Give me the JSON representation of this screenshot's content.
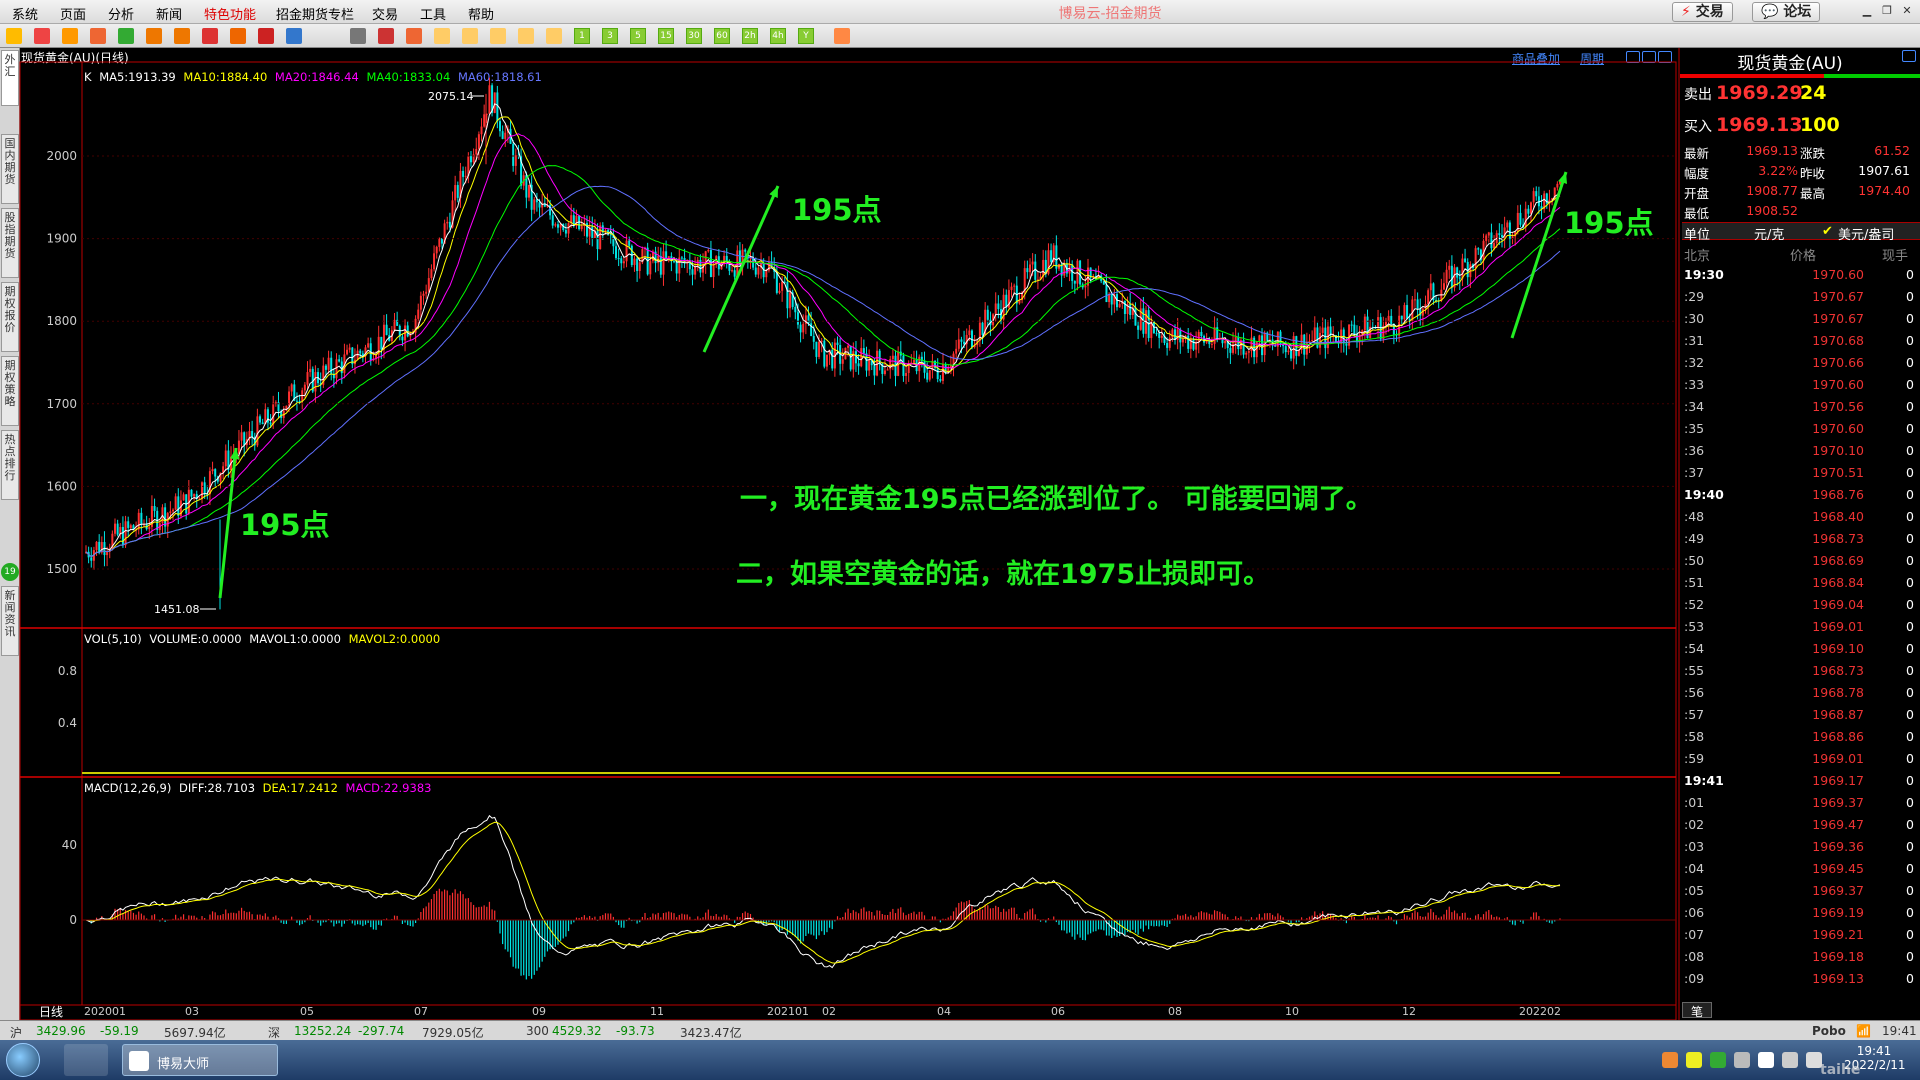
{
  "menu": [
    "系统",
    "页面",
    "分析",
    "新闻",
    "特色功能",
    "招金期货专栏",
    "交易",
    "工具",
    "帮助"
  ],
  "app_title": "博易云-招金期货",
  "top_buttons": {
    "trade": "交易",
    "forum": "论坛"
  },
  "left_tabs": [
    "外汇",
    "国内期货",
    "股指期货",
    "期权报价",
    "期权策略",
    "热点排行",
    "新闻资讯"
  ],
  "left_badge": "19",
  "chart": {
    "title": "现货黄金(AU)(日线)",
    "links": [
      "商品叠加",
      "周期"
    ],
    "k_legend": {
      "label": "K",
      "ma5": "MA5:1913.39",
      "ma10": "MA10:1884.40",
      "ma20": "MA20:1846.44",
      "ma40": "MA40:1833.04",
      "ma60": "MA60:1818.61"
    },
    "vol_legend": {
      "label": "VOL(5,10)",
      "volume": "VOLUME:0.0000",
      "mavol1": "MAVOL1:0.0000",
      "mavol2": "MAVOL2:0.0000"
    },
    "macd_legend": {
      "label": "MACD(12,26,9)",
      "diff": "DIFF:28.7103",
      "dea": "DEA:17.2412",
      "macd": "MACD:22.9383"
    },
    "price_ticks": [
      "2000",
      "1900",
      "1800",
      "1700",
      "1600",
      "1500"
    ],
    "vol_ticks": [
      "0.8",
      "0.4"
    ],
    "macd_ticks": [
      "40",
      "0"
    ],
    "date_ticks": [
      "202001",
      "03",
      "05",
      "07",
      "09",
      "11",
      "202101",
      "02",
      "04",
      "06",
      "08",
      "10",
      "12",
      "202202"
    ],
    "period_label": "日线",
    "high_label": "2075.14",
    "low_label": "1451.08",
    "annotations": {
      "a1": "195点",
      "a2": "195点",
      "a3": "195点",
      "line1": "一，现在黄金195点已经涨到位了。 可能要回调了。",
      "line2": "二，如果空黄金的话，就在1975止损即可。"
    }
  },
  "chart_data": {
    "type": "line",
    "title": "现货黄金(AU)(日线)",
    "x": [
      "202001",
      "202003",
      "202005",
      "202007",
      "202008",
      "202009",
      "202011",
      "202101",
      "202102",
      "202104",
      "202106",
      "202108",
      "202110",
      "202112",
      "202202"
    ],
    "values": [
      1520,
      1580,
      1720,
      1800,
      2075.14,
      1940,
      1870,
      1870,
      1760,
      1740,
      1880,
      1780,
      1770,
      1800,
      1969.13
    ],
    "ylim": [
      1450,
      2080
    ],
    "high": 2075.14,
    "low": 1451.08,
    "colors": {
      "up": "#ff3030",
      "down": "#00e5e5",
      "ma5": "#ffffff",
      "ma10": "#ffff00",
      "ma20": "#ff00ff",
      "ma40": "#00ff00",
      "ma60": "#6070ff"
    }
  },
  "quote": {
    "title": "现货黄金(AU)",
    "sell_label": "卖出",
    "sell_price": "1969.29",
    "sell_vol": "24",
    "buy_label": "买入",
    "buy_price": "1969.13",
    "buy_vol": "100",
    "rows": [
      {
        "l1": "最新",
        "v1": "1969.13",
        "l2": "涨跌",
        "v2": "61.52"
      },
      {
        "l1": "幅度",
        "v1": "3.22%",
        "l2": "昨收",
        "v2": "1907.61"
      },
      {
        "l1": "开盘",
        "v1": "1908.77",
        "l2": "最高",
        "v2": "1974.40"
      },
      {
        "l1": "最低",
        "v1": "1908.52",
        "l2": "",
        "v2": ""
      }
    ],
    "unit_label": "单位",
    "unit_value": "元/克",
    "unit_alt": "美元/盎司",
    "tick_headers": {
      "time": "北京",
      "price": "价格",
      "vol": "现手"
    },
    "ticks": [
      {
        "t": "19:30",
        "p": "1970.60",
        "v": "0",
        "b": true
      },
      {
        "t": ":29",
        "p": "1970.67",
        "v": "0"
      },
      {
        "t": ":30",
        "p": "1970.67",
        "v": "0"
      },
      {
        "t": ":31",
        "p": "1970.68",
        "v": "0"
      },
      {
        "t": ":32",
        "p": "1970.66",
        "v": "0"
      },
      {
        "t": ":33",
        "p": "1970.60",
        "v": "0"
      },
      {
        "t": ":34",
        "p": "1970.56",
        "v": "0"
      },
      {
        "t": ":35",
        "p": "1970.60",
        "v": "0"
      },
      {
        "t": ":36",
        "p": "1970.10",
        "v": "0"
      },
      {
        "t": ":37",
        "p": "1970.51",
        "v": "0"
      },
      {
        "t": "19:40",
        "p": "1968.76",
        "v": "0",
        "b": true
      },
      {
        "t": ":48",
        "p": "1968.40",
        "v": "0"
      },
      {
        "t": ":49",
        "p": "1968.73",
        "v": "0"
      },
      {
        "t": ":50",
        "p": "1968.69",
        "v": "0"
      },
      {
        "t": ":51",
        "p": "1968.84",
        "v": "0"
      },
      {
        "t": ":52",
        "p": "1969.04",
        "v": "0"
      },
      {
        "t": ":53",
        "p": "1969.01",
        "v": "0"
      },
      {
        "t": ":54",
        "p": "1969.10",
        "v": "0"
      },
      {
        "t": ":55",
        "p": "1968.73",
        "v": "0"
      },
      {
        "t": ":56",
        "p": "1968.78",
        "v": "0"
      },
      {
        "t": ":57",
        "p": "1968.87",
        "v": "0"
      },
      {
        "t": ":58",
        "p": "1968.86",
        "v": "0"
      },
      {
        "t": ":59",
        "p": "1969.01",
        "v": "0"
      },
      {
        "t": "19:41",
        "p": "1969.17",
        "v": "0",
        "b": true
      },
      {
        "t": ":01",
        "p": "1969.37",
        "v": "0"
      },
      {
        "t": ":02",
        "p": "1969.47",
        "v": "0"
      },
      {
        "t": ":03",
        "p": "1969.36",
        "v": "0"
      },
      {
        "t": ":04",
        "p": "1969.45",
        "v": "0"
      },
      {
        "t": ":05",
        "p": "1969.37",
        "v": "0"
      },
      {
        "t": ":06",
        "p": "1969.19",
        "v": "0"
      },
      {
        "t": ":07",
        "p": "1969.21",
        "v": "0"
      },
      {
        "t": ":08",
        "p": "1969.18",
        "v": "0"
      },
      {
        "t": ":09",
        "p": "1969.13",
        "v": "0"
      }
    ],
    "bottom_tab": "笔"
  },
  "status": {
    "items": [
      {
        "k": "沪",
        "v": "3429.96",
        "c": "-59.19",
        "a": "5697.94亿"
      },
      {
        "k": "深",
        "v": "13252.24",
        "c": "-297.74",
        "a": "7929.05亿"
      },
      {
        "k": "300",
        "v": "4529.32",
        "c": "-93.73",
        "a": "3423.47亿"
      }
    ],
    "brand": "Pobo",
    "time": "19:41"
  },
  "taskbar": {
    "app": "博易大师",
    "time": "19:41",
    "date": "2022/2/11",
    "watermark": "taihe"
  }
}
